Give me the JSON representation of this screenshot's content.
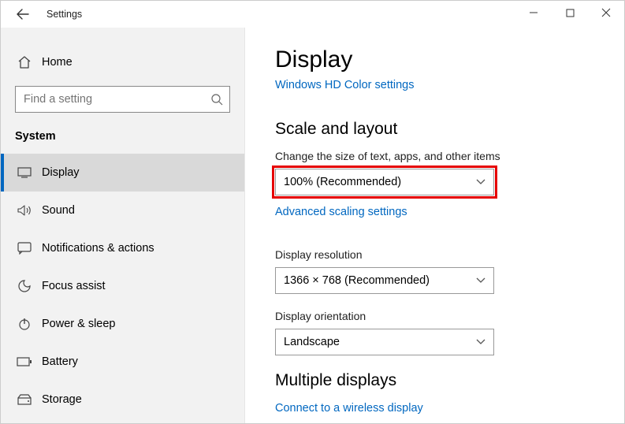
{
  "window": {
    "title": "Settings"
  },
  "sidebar": {
    "home_label": "Home",
    "search_placeholder": "Find a setting",
    "section_label": "System",
    "items": [
      {
        "label": "Display"
      },
      {
        "label": "Sound"
      },
      {
        "label": "Notifications & actions"
      },
      {
        "label": "Focus assist"
      },
      {
        "label": "Power & sleep"
      },
      {
        "label": "Battery"
      },
      {
        "label": "Storage"
      }
    ]
  },
  "main": {
    "heading": "Display",
    "hd_color_link": "Windows HD Color settings",
    "section_scale_heading": "Scale and layout",
    "scale": {
      "label": "Change the size of text, apps, and other items",
      "value": "100% (Recommended)",
      "advanced_link": "Advanced scaling settings"
    },
    "resolution": {
      "label": "Display resolution",
      "value": "1366 × 768 (Recommended)"
    },
    "orientation": {
      "label": "Display orientation",
      "value": "Landscape"
    },
    "section_multi_heading": "Multiple displays",
    "wireless_link": "Connect to a wireless display"
  }
}
